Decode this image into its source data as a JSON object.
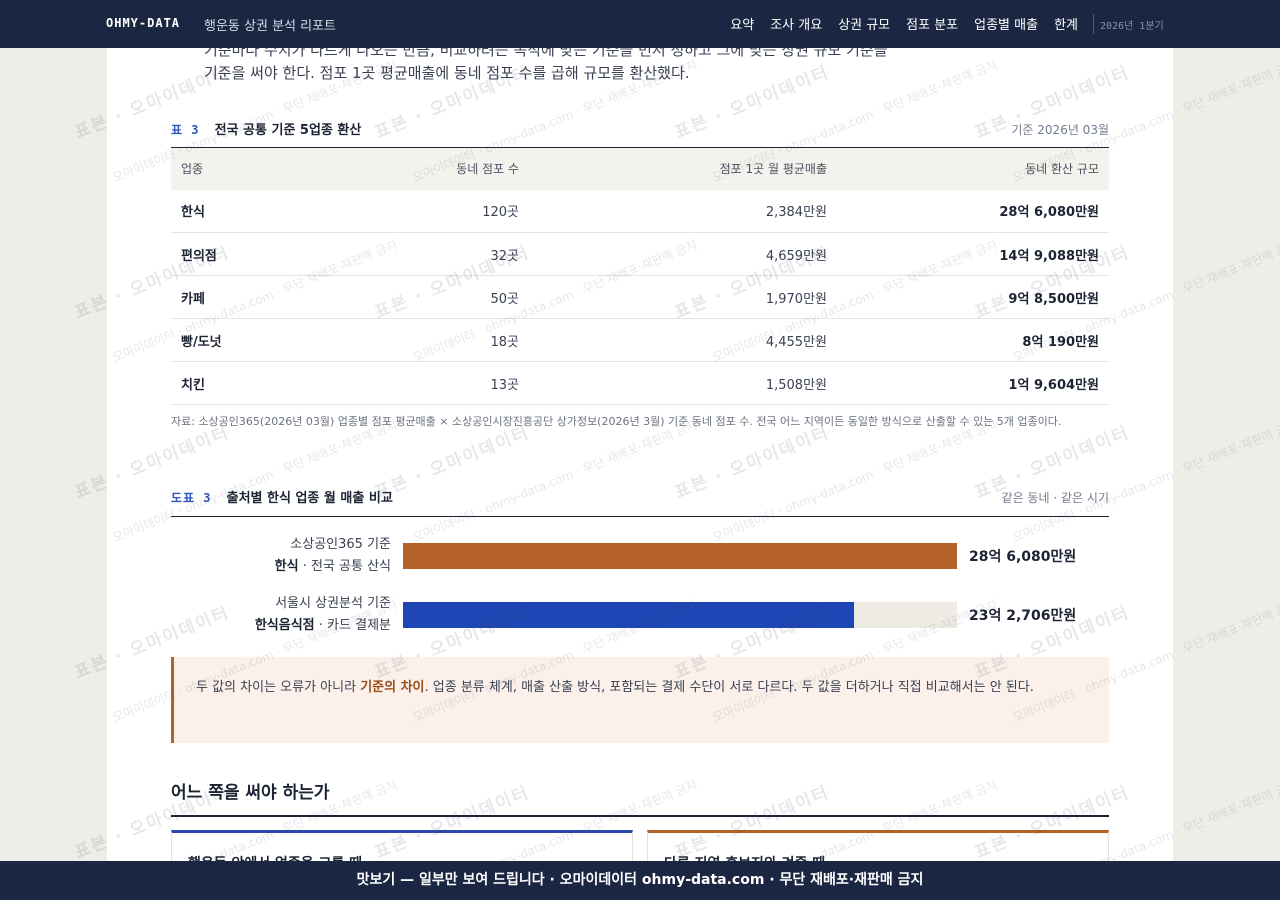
{
  "header": {
    "brand": "OHMY-DATA",
    "report_title": "행운동 상권 분석 리포트",
    "nav": [
      "요약",
      "조사 개요",
      "상권 규모",
      "점포 분포",
      "업종별 매출",
      "한계"
    ],
    "period": "2026년 1분기"
  },
  "intro": {
    "line1_fragment": "기준마다 수치가 다르게 나오는 만큼, 비교하려는 목적에 맞는 기준을 먼저 정하고 그에 맞는 상권 규모 기준을",
    "line2": "기준을 써야 한다. 점포 1곳 평균매출에 동네 점포 수를 곱해 규모를 환산했다."
  },
  "table3": {
    "num": "표 3",
    "title": "전국 공통 기준 5업종 환산",
    "meta": "기준 2026년 03월",
    "headers": [
      "업종",
      "동네 점포 수",
      "점포 1곳 월 평균매출",
      "동네 환산 규모"
    ],
    "rows": [
      [
        "한식",
        "120곳",
        "2,384만원",
        "28억 6,080만원"
      ],
      [
        "편의점",
        "32곳",
        "4,659만원",
        "14억 9,088만원"
      ],
      [
        "카페",
        "50곳",
        "1,970만원",
        "9억 8,500만원"
      ],
      [
        "빵/도넛",
        "18곳",
        "4,455만원",
        "8억 190만원"
      ],
      [
        "치킨",
        "13곳",
        "1,508만원",
        "1억 9,604만원"
      ]
    ],
    "source": "자료: 소상공인365(2026년 03월) 업종별 점포 평균매출 × 소상공인시장진흥공단 상가정보(2026년 3월) 기준 동네 점포 수. 전국 어느 지역이든 동일한 방식으로 산출할 수 있는 5개 업종이다."
  },
  "figure3": {
    "num": "도표 3",
    "title": "출처별 한식 업종 월 매출 비교",
    "meta": "같은 동네 · 같은 시기",
    "bars": [
      {
        "source": "소상공인365 기준",
        "category": "한식",
        "method": " · 전국 공통 산식",
        "value_label": "28억 6,080만원",
        "value": 286080,
        "color": "#b5612a"
      },
      {
        "source": "서울시 상권분석 기준",
        "category": "한식음식점",
        "method": " · 카드 결제분",
        "value_label": "23억 2,706만원",
        "value": 232706,
        "color": "#1e46b4"
      }
    ]
  },
  "callout": {
    "before": "두 값의 차이는 오류가 아니라 ",
    "emphasis": "기준의 차이",
    "after": ". 업종 분류 체계, 매출 산출 방식, 포함되는 결제 수단이 서로 다르다. 두 값을 더하거나 직접 비교해서는 안 된다."
  },
  "section": {
    "title": "어느 쪽을 써야 하는가",
    "option_a": "행운동 안에서 업종을 고를 때",
    "option_b": "다른 지역 후보지와 겨줄 때"
  },
  "watermark": {
    "big": "표본 · 오마이데이터",
    "small": "오마이데이터 · ohmy-data.com · 무단 재배포·재판매 금지"
  },
  "banner": "맛보기 — 일부만 보여 드립니다 · 오마이데이터 ohmy-data.com · 무단 재배포·재판매 금지"
}
